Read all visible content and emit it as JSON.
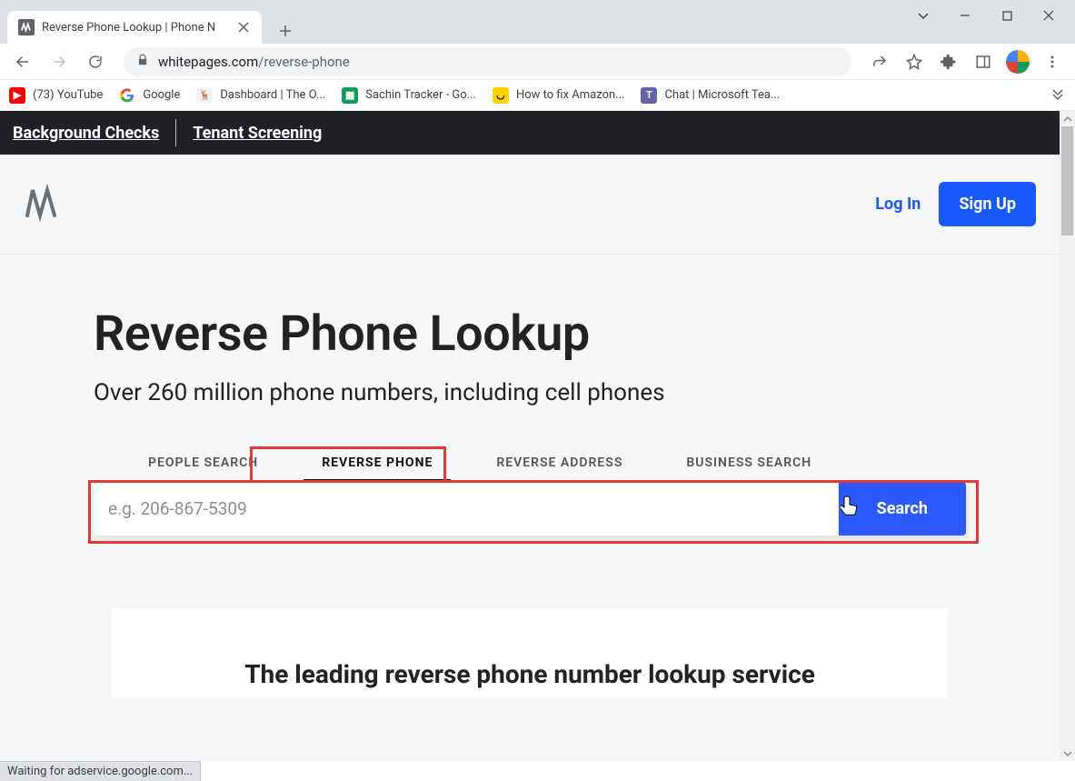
{
  "browser": {
    "tab_title": "Reverse Phone Lookup | Phone N",
    "url_host": "whitepages.com",
    "url_path": "/reverse-phone"
  },
  "bookmarks": [
    {
      "label": "(73) YouTube"
    },
    {
      "label": "Google"
    },
    {
      "label": "Dashboard | The O..."
    },
    {
      "label": "Sachin Tracker - Go..."
    },
    {
      "label": "How to fix Amazon..."
    },
    {
      "label": "Chat | Microsoft Tea..."
    }
  ],
  "topbar": {
    "link1": "Background Checks",
    "link2": "Tenant Screening"
  },
  "header": {
    "login": "Log In",
    "signup": "Sign Up"
  },
  "hero": {
    "title": "Reverse Phone Lookup",
    "subtitle": "Over 260 million phone numbers, including cell phones"
  },
  "tabs": {
    "people": "PEOPLE SEARCH",
    "reverse_phone": "REVERSE PHONE",
    "reverse_address": "REVERSE ADDRESS",
    "business": "BUSINESS SEARCH"
  },
  "search": {
    "placeholder": "e.g. 206-867-5309",
    "button": "Search"
  },
  "card": {
    "heading": "The leading reverse phone number lookup service"
  },
  "status": "Waiting for adservice.google.com..."
}
